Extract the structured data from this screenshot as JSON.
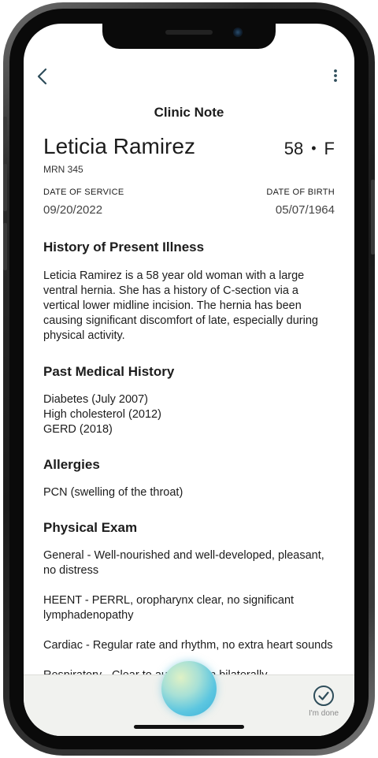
{
  "header": {
    "title": "Clinic Note"
  },
  "patient": {
    "name": "Leticia Ramirez",
    "age": "58",
    "separator": "•",
    "sex": "F",
    "mrn": "MRN 345"
  },
  "dates": {
    "service_label": "DATE OF SERVICE",
    "service_value": "09/20/2022",
    "birth_label": "DATE OF BIRTH",
    "birth_value": "05/07/1964"
  },
  "sections": {
    "hpi": {
      "heading": "History of Present Illness",
      "text": "Leticia Ramirez is a 58 year old woman with a large ventral hernia. She has a history of C-section via a vertical lower midline incision. The hernia has been causing significant discomfort of late, especially during physical activity."
    },
    "pmh": {
      "heading": "Past Medical History",
      "items": [
        "Diabetes (July 2007)",
        "High cholesterol (2012)",
        "GERD (2018)"
      ]
    },
    "allergies": {
      "heading": "Allergies",
      "text": "PCN (swelling of the throat)"
    },
    "exam": {
      "heading": "Physical Exam",
      "general": "General - Well-nourished and well-developed, pleasant, no distress",
      "heent": "HEENT - PERRL, oropharynx clear, no significant lymphadenopathy",
      "cardiac": "Cardiac - Regular rate and rhythm, no extra heart sounds",
      "respiratory": "Respiratory - Clear to auscultation bilaterally"
    }
  },
  "bottom": {
    "done_label": "I'm done"
  },
  "icons": {
    "back": "chevron-left-icon",
    "more": "more-vertical-icon",
    "done": "check-circle-icon",
    "assistant": "assistant-orb"
  },
  "colors": {
    "accent": "#2e4d5a",
    "bottom_bar": "#f1f2ef",
    "muted": "#8a8a8a"
  }
}
